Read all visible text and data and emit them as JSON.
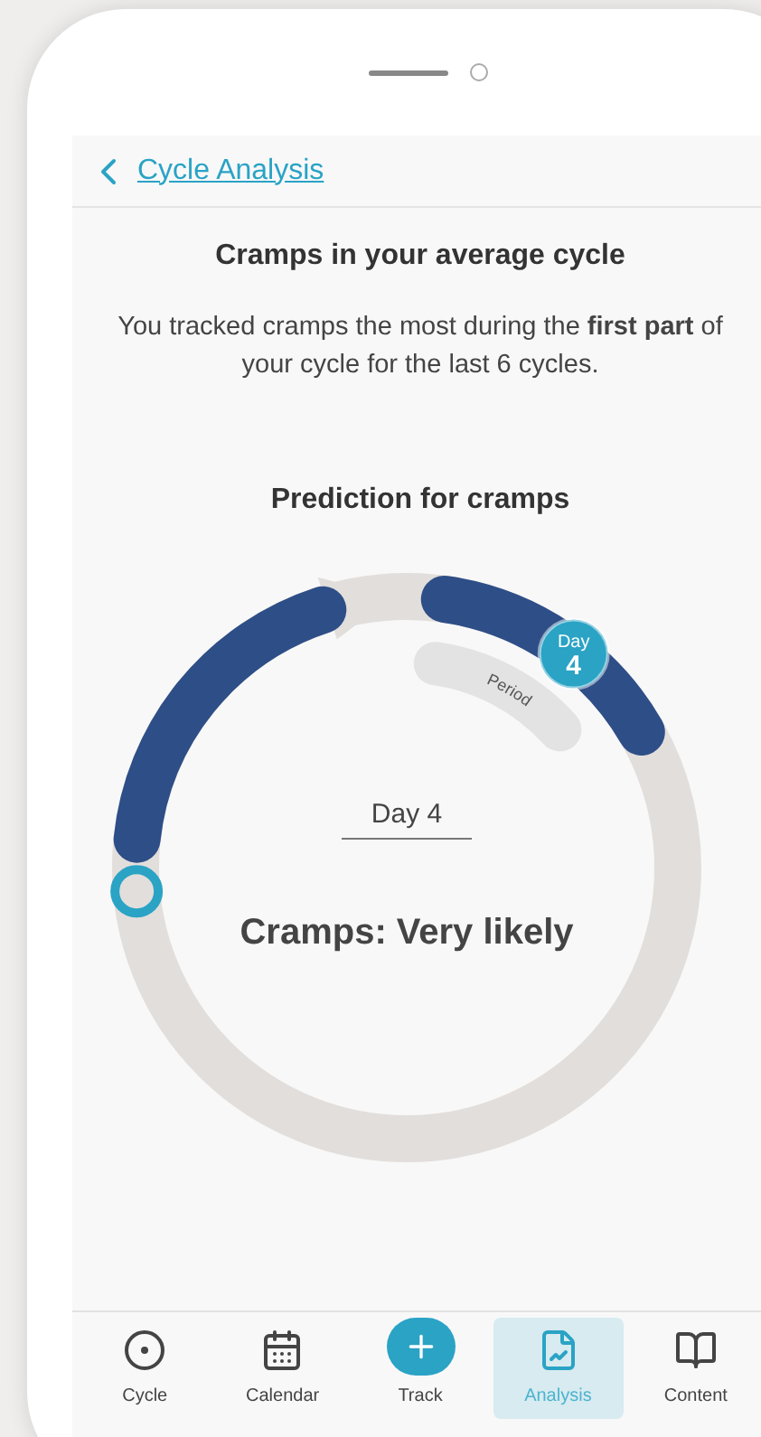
{
  "header": {
    "back_link": "Cycle Analysis"
  },
  "title": "Cramps in your average cycle",
  "summary": "You tracked cramps the most during the **first part** of your cycle for the last 6 cycles.",
  "prediction": {
    "title": "Prediction for cramps",
    "badge_label": "Day",
    "badge_day": "4",
    "period_label": "Period",
    "day_label": "Day 4",
    "result": "Cramps: Very likely"
  },
  "nav": [
    {
      "label": "Cycle",
      "kind": "cycle",
      "selected": false
    },
    {
      "label": "Calendar",
      "kind": "calendar",
      "selected": false
    },
    {
      "label": "Track",
      "kind": "add",
      "selected": false
    },
    {
      "label": "Analysis",
      "kind": "analysis",
      "selected": true
    },
    {
      "label": "Content",
      "kind": "content",
      "selected": false
    }
  ]
}
